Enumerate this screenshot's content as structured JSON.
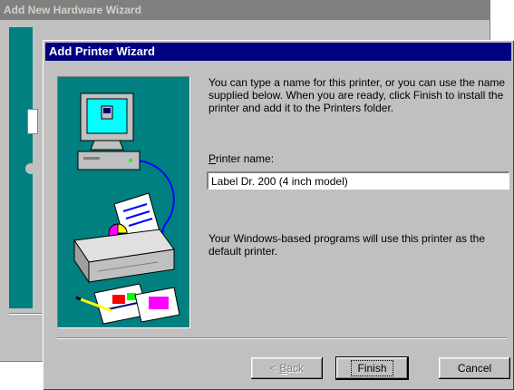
{
  "background_window": {
    "title": "Add New Hardware Wizard"
  },
  "dialog": {
    "title": "Add Printer Wizard",
    "intro": "You can type a name for this printer, or you can use the name supplied below. When you are ready, click Finish to install the printer and add it to the Printers folder.",
    "printer_name_label_hotkey": "P",
    "printer_name_label_rest": "rinter name:",
    "printer_name_value": "Label Dr. 200 (4 inch model)",
    "note": "Your Windows-based programs will use this printer as the default printer."
  },
  "buttons": {
    "back_prefix": "< ",
    "back_hotkey": "B",
    "back_rest": "ack",
    "finish": "Finish",
    "cancel": "Cancel"
  },
  "colors": {
    "title_active": "#000080",
    "title_inactive": "#808080",
    "illustration_bg": "#008080",
    "face": "#c0c0c0"
  }
}
